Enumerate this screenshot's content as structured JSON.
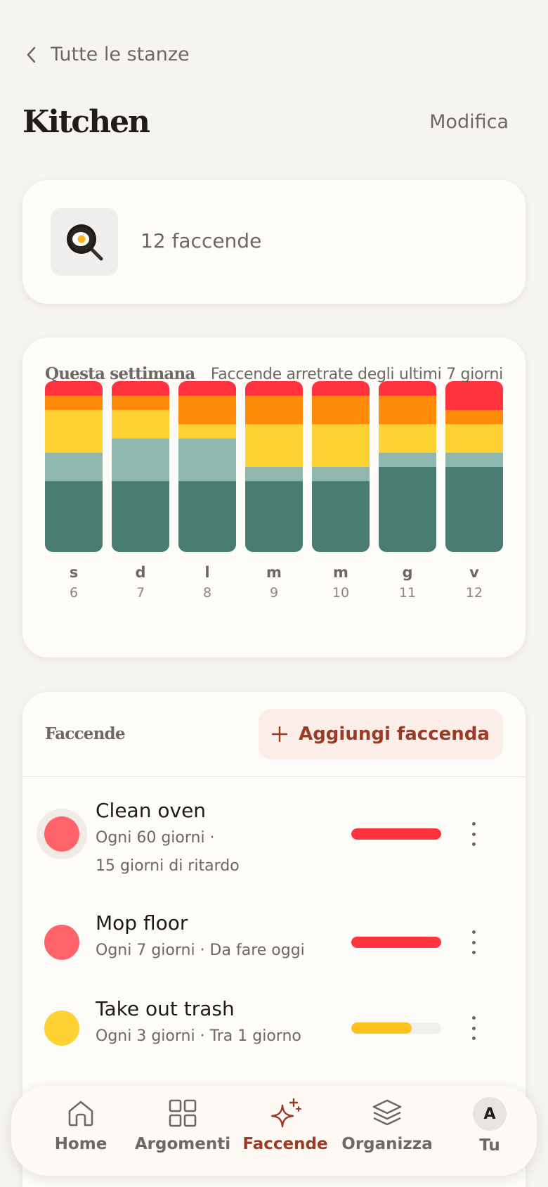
{
  "header": {
    "back_label": "Tutte le stanze",
    "title": "Kitchen",
    "edit_label": "Modifica"
  },
  "room": {
    "icon": "frying-pan-egg-icon",
    "chore_count_label": "12 faccende"
  },
  "week": {
    "title": "Questa settimana",
    "subtitle": "Faccende arretrate degli ultimi 7 giorni"
  },
  "colors": {
    "red": "#ff323e",
    "orange": "#ff8a0a",
    "yellow": "#ffd233",
    "sage": "#8fb7ad",
    "teal": "#497d71",
    "accent": "#9a3b26"
  },
  "chart_data": {
    "type": "bar",
    "stacked": true,
    "categories": [
      "s",
      "d",
      "l",
      "m",
      "m",
      "g",
      "v"
    ],
    "day_numbers": [
      "6",
      "7",
      "8",
      "9",
      "10",
      "11",
      "12"
    ],
    "series": [
      {
        "color": "#497d71",
        "values": [
          5,
          5,
          5,
          5,
          5,
          6,
          6
        ]
      },
      {
        "color": "#8fb7ad",
        "values": [
          2,
          3,
          3,
          1,
          1,
          1,
          1
        ]
      },
      {
        "color": "#ffd233",
        "values": [
          3,
          2,
          1,
          3,
          3,
          2,
          2
        ]
      },
      {
        "color": "#ff8a0a",
        "values": [
          1,
          1,
          2,
          2,
          2,
          2,
          1
        ]
      },
      {
        "color": "#ff323e",
        "values": [
          1,
          1,
          1,
          1,
          1,
          1,
          2
        ]
      }
    ],
    "ylim": [
      0,
      12
    ]
  },
  "chores": {
    "title": "Faccende",
    "add_label": "Aggiungi faccenda",
    "items": [
      {
        "name": "Clean oven",
        "meta1": "Ogni 60 giorni ·",
        "meta2": "15 giorni di ritardo",
        "dot_color": "#ff636a",
        "progress": 1.0,
        "bar_color": "#ff323e"
      },
      {
        "name": "Mop floor",
        "meta1": "Ogni 7 giorni · Da fare oggi",
        "meta2": "",
        "dot_color": "#ff636a",
        "progress": 1.0,
        "bar_color": "#ff323e"
      },
      {
        "name": "Take out trash",
        "meta1": "Ogni 3 giorni · Tra 1 giorno",
        "meta2": "",
        "dot_color": "#ffd233",
        "progress": 0.67,
        "bar_color": "#ffc21a"
      }
    ]
  },
  "nav": {
    "items": [
      {
        "label": "Home",
        "icon": "home-icon"
      },
      {
        "label": "Argomenti",
        "icon": "grid-icon"
      },
      {
        "label": "Faccende",
        "icon": "sparkle-icon"
      },
      {
        "label": "Organizza",
        "icon": "layers-icon"
      },
      {
        "label": "Tu",
        "icon": "avatar"
      }
    ],
    "avatar_letter": "A"
  }
}
